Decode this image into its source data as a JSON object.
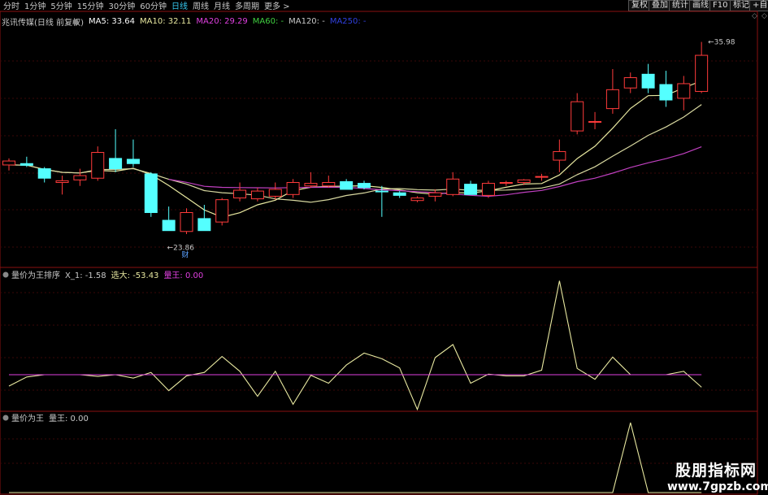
{
  "toolbar": {
    "periods": [
      "分时",
      "1分钟",
      "5分钟",
      "15分钟",
      "30分钟",
      "60分钟",
      "日线",
      "周线",
      "月线",
      "多周期",
      "更多 >"
    ],
    "active": "日线",
    "right_buttons": [
      "复权",
      "叠加",
      "统计",
      "画线",
      "F10",
      "标记",
      "+自选"
    ]
  },
  "main_panel": {
    "title": "兆讯传媒(日线 前复权)",
    "ma": [
      {
        "label": "MA5: 33.64",
        "color": "#ffffff"
      },
      {
        "label": "MA10: 32.11",
        "color": "#e8e8a0"
      },
      {
        "label": "MA20: 29.29",
        "color": "#e040e0"
      },
      {
        "label": "MA60: -",
        "color": "#40d040"
      },
      {
        "label": "MA120: -",
        "color": "#c8c8c8"
      },
      {
        "label": "MA250: -",
        "color": "#3040e0"
      }
    ],
    "high_label": "35.98",
    "low_label": "23.86",
    "badge": "财"
  },
  "ind1": {
    "title": "量价为王排序",
    "items": [
      {
        "label": "X_1: -1.58",
        "color": "#c8c8c8"
      },
      {
        "label": "选大: -53.43",
        "color": "#e8e8a0"
      },
      {
        "label": "量王: 0.00",
        "color": "#e040e0"
      }
    ]
  },
  "ind2": {
    "title": "量价为王",
    "items": [
      {
        "label": "量王: 0.00",
        "color": "#c8c8c8"
      }
    ]
  },
  "watermark": {
    "line1": "股朋指标网",
    "line2": "www.7gpzb.com"
  },
  "chart_data": {
    "type": "candlestick",
    "price_range": [
      23.0,
      37.0
    ],
    "candles": [
      {
        "o": 29.05,
        "h": 29.2,
        "l": 28.5,
        "c": 28.82,
        "dir": "up"
      },
      {
        "o": 28.9,
        "h": 29.3,
        "l": 28.7,
        "c": 28.8,
        "dir": "down"
      },
      {
        "o": 28.6,
        "h": 28.7,
        "l": 27.8,
        "c": 28.05,
        "dir": "down"
      },
      {
        "o": 27.8,
        "h": 28.2,
        "l": 27.1,
        "c": 27.9,
        "dir": "up"
      },
      {
        "o": 27.95,
        "h": 28.6,
        "l": 27.6,
        "c": 28.2,
        "dir": "up"
      },
      {
        "o": 28.05,
        "h": 29.9,
        "l": 27.9,
        "c": 29.55,
        "dir": "up"
      },
      {
        "o": 29.2,
        "h": 30.9,
        "l": 28.4,
        "c": 28.6,
        "dir": "down"
      },
      {
        "o": 29.15,
        "h": 30.3,
        "l": 28.7,
        "c": 28.9,
        "dir": "down"
      },
      {
        "o": 28.3,
        "h": 28.4,
        "l": 25.8,
        "c": 26.05,
        "dir": "down"
      },
      {
        "o": 25.6,
        "h": 26.4,
        "l": 25.3,
        "c": 25.0,
        "dir": "down"
      },
      {
        "o": 24.95,
        "h": 26.3,
        "l": 24.8,
        "c": 26.05,
        "dir": "up"
      },
      {
        "o": 25.7,
        "h": 26.5,
        "l": 25.0,
        "c": 25.0,
        "dir": "down"
      },
      {
        "o": 25.5,
        "h": 26.9,
        "l": 25.3,
        "c": 26.8,
        "dir": "up"
      },
      {
        "o": 26.9,
        "h": 27.8,
        "l": 26.7,
        "c": 27.35,
        "dir": "up"
      },
      {
        "o": 26.85,
        "h": 27.5,
        "l": 26.7,
        "c": 27.3,
        "dir": "up"
      },
      {
        "o": 27.0,
        "h": 27.8,
        "l": 26.8,
        "c": 27.4,
        "dir": "up"
      },
      {
        "o": 27.1,
        "h": 28.0,
        "l": 26.9,
        "c": 27.8,
        "dir": "up"
      },
      {
        "o": 27.6,
        "h": 28.4,
        "l": 27.5,
        "c": 27.75,
        "dir": "up"
      },
      {
        "o": 27.8,
        "h": 28.2,
        "l": 27.5,
        "c": 27.6,
        "dir": "up"
      },
      {
        "o": 27.85,
        "h": 28.0,
        "l": 27.6,
        "c": 27.4,
        "dir": "down"
      },
      {
        "o": 27.75,
        "h": 27.9,
        "l": 27.4,
        "c": 27.5,
        "dir": "down"
      },
      {
        "o": 27.3,
        "h": 27.6,
        "l": 25.8,
        "c": 27.3,
        "dir": "down"
      },
      {
        "o": 27.2,
        "h": 27.3,
        "l": 26.9,
        "c": 27.05,
        "dir": "down"
      },
      {
        "o": 26.9,
        "h": 27.0,
        "l": 26.65,
        "c": 26.75,
        "dir": "up"
      },
      {
        "o": 27.2,
        "h": 27.4,
        "l": 26.7,
        "c": 27.0,
        "dir": "up"
      },
      {
        "o": 27.1,
        "h": 28.4,
        "l": 27.0,
        "c": 28.0,
        "dir": "up"
      },
      {
        "o": 27.7,
        "h": 27.9,
        "l": 27.1,
        "c": 27.1,
        "dir": "down"
      },
      {
        "o": 27.05,
        "h": 27.9,
        "l": 26.9,
        "c": 27.75,
        "dir": "up"
      },
      {
        "o": 27.8,
        "h": 27.9,
        "l": 27.6,
        "c": 27.75,
        "dir": "up"
      },
      {
        "o": 27.8,
        "h": 28.0,
        "l": 27.65,
        "c": 27.95,
        "dir": "up"
      },
      {
        "o": 28.15,
        "h": 28.3,
        "l": 27.9,
        "c": 28.15,
        "dir": "up"
      },
      {
        "o": 29.1,
        "h": 30.3,
        "l": 28.4,
        "c": 29.6,
        "dir": "up"
      },
      {
        "o": 30.8,
        "h": 33.0,
        "l": 30.6,
        "c": 32.5,
        "dir": "up"
      },
      {
        "o": 31.35,
        "h": 31.9,
        "l": 30.9,
        "c": 31.35,
        "dir": "up"
      },
      {
        "o": 32.1,
        "h": 34.4,
        "l": 31.8,
        "c": 33.2,
        "dir": "up"
      },
      {
        "o": 33.3,
        "h": 34.2,
        "l": 33.0,
        "c": 33.9,
        "dir": "up"
      },
      {
        "o": 34.1,
        "h": 34.7,
        "l": 33.0,
        "c": 33.3,
        "dir": "down"
      },
      {
        "o": 33.5,
        "h": 34.3,
        "l": 32.2,
        "c": 32.6,
        "dir": "down"
      },
      {
        "o": 32.7,
        "h": 34.0,
        "l": 32.0,
        "c": 33.55,
        "dir": "up"
      },
      {
        "o": 33.1,
        "h": 35.98,
        "l": 33.0,
        "c": 35.2,
        "dir": "up"
      }
    ],
    "ind1_values": [
      -2,
      -0.4,
      0,
      0,
      0,
      -0.3,
      0,
      -0.6,
      0.4,
      -2.8,
      -0.2,
      0.4,
      3.2,
      0.6,
      -3.8,
      0.6,
      -5.2,
      -0.1,
      -1.5,
      1.7,
      3.8,
      2.8,
      1.2,
      -6.1,
      3.0,
      5.3,
      -1.5,
      0.1,
      -0.2,
      -0.2,
      0.8,
      16.5,
      1.1,
      -0.8,
      3.1,
      0,
      0,
      0,
      0.6,
      -2.2
    ],
    "ind2_values": [
      0,
      0,
      0,
      0,
      0,
      0,
      0,
      0,
      0,
      0,
      0,
      0,
      0,
      0,
      0,
      0,
      0,
      0,
      0,
      0,
      0,
      0,
      0,
      0,
      0,
      0,
      0,
      0,
      0,
      0,
      0,
      0,
      0,
      0,
      0,
      10,
      0,
      0,
      0,
      0
    ]
  }
}
